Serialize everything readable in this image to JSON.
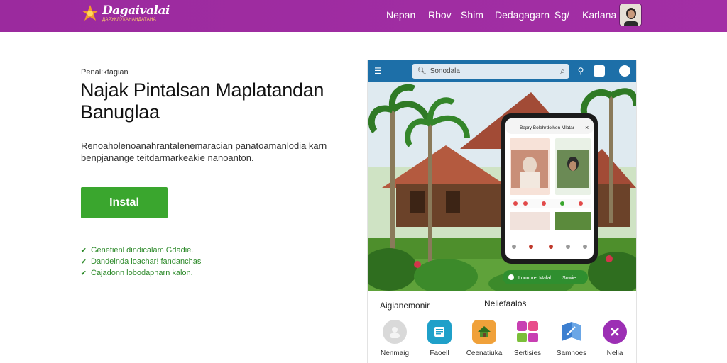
{
  "header": {
    "brand_name": "Dagaivalai",
    "brand_tagline": "ДАРУКЛУКАНАНДАТАНА",
    "nav": [
      "Nepan",
      "Rbov",
      "Shim",
      "Dedagagarn",
      "Sg/",
      "Karlana"
    ],
    "accent_color": "#9b2a9e"
  },
  "hero": {
    "kicker": "Penal:ktagian",
    "title": "Najak Pintalsan Maplatandan Banuglaa",
    "description": "Renoaholenoanahrantalenemaracian panatoamanlodia karn benpjanange teitdarmarkeakie nanoanton.",
    "install_label": "Instal",
    "install_color": "#3aa62e",
    "features": [
      "Genetienl dindicalam Gdadie.",
      "Dandeinda loachar! fandanchas",
      "Cajadonn lobodapnarn kalon."
    ]
  },
  "preview": {
    "search_placeholder": "Sonodala",
    "phone_title": "Bapry Bolahrdolhen Mlatar",
    "phone_cta": "Loonhrel Malal",
    "phone_cta_secondary": "Sowie",
    "section_left": "Aigianemonir",
    "section_right": "Neliefaalos",
    "apps": [
      {
        "label": "Nenmaig",
        "icon": "avatar-icon",
        "color": "#d9d9d9"
      },
      {
        "label": "Faoell",
        "icon": "document-icon",
        "color": "#1fa0c9"
      },
      {
        "label": "Ceenatiuka",
        "icon": "house-icon",
        "color": "#f0a13a"
      },
      {
        "label": "Sertisies",
        "icon": "collage-icon",
        "color": "#c83fb2"
      },
      {
        "label": "Samnoes",
        "icon": "map-icon",
        "color": "#3c7fd0"
      },
      {
        "label": "Nelia",
        "icon": "close-circle-icon",
        "color": "#9c2fb4"
      }
    ]
  }
}
